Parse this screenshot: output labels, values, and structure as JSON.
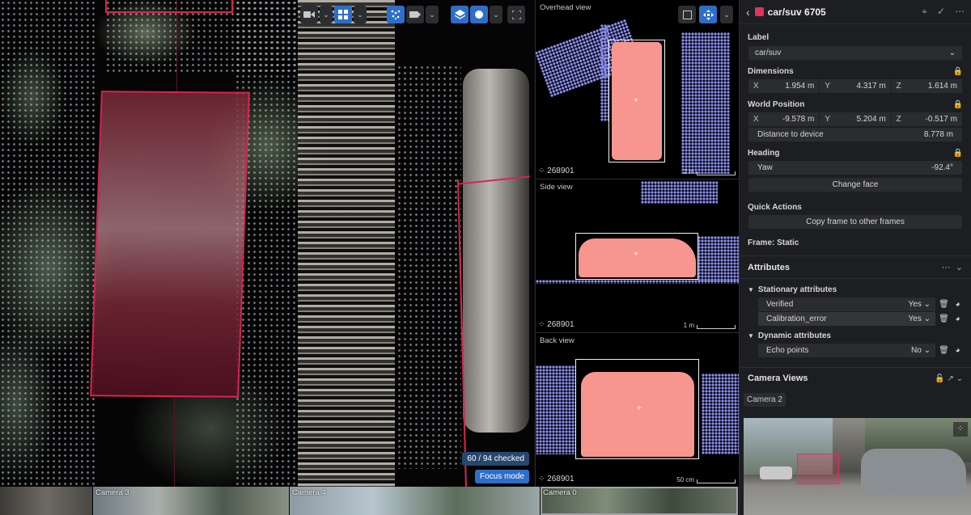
{
  "viewport": {
    "progress_badge": "60 / 94 checked",
    "focus_mode_label": "Focus mode",
    "toolbar": [
      {
        "icon": "video-camera-icon",
        "active": false
      },
      {
        "icon": "grid-layout-icon",
        "active": true
      },
      {
        "icon": "points-icon",
        "active": true
      },
      {
        "icon": "label-tag-icon",
        "active": false
      },
      {
        "icon": "layers-icon",
        "active": true
      },
      {
        "icon": "circle-icon",
        "active": true
      },
      {
        "icon": "fullscreen-icon",
        "active": false
      }
    ]
  },
  "views": {
    "overhead": {
      "label": "Overhead view",
      "id": "268901",
      "scale": "2 m"
    },
    "side": {
      "label": "Side view",
      "id": "268901",
      "scale": "1 m"
    },
    "back": {
      "label": "Back view",
      "id": "268901",
      "scale": "50 cm"
    }
  },
  "panel": {
    "title": "car/suv 6705",
    "accent_color": "#e0335a",
    "label_section": "Label",
    "label_value": "car/suv",
    "dimensions_section": "Dimensions",
    "dimensions": {
      "x_key": "X",
      "x": "1.954 m",
      "y_key": "Y",
      "y": "4.317 m",
      "z_key": "Z",
      "z": "1.614 m"
    },
    "world_position_section": "World Position",
    "world_position": {
      "x_key": "X",
      "x": "-9.578 m",
      "y_key": "Y",
      "y": "5.204 m",
      "z_key": "Z",
      "z": "-0.517 m"
    },
    "distance_label": "Distance to device",
    "distance_value": "8.778 m",
    "heading_section": "Heading",
    "yaw_label": "Yaw",
    "yaw_value": "-92.4°",
    "change_face_label": "Change face",
    "quick_actions_section": "Quick Actions",
    "copy_frame_label": "Copy frame to other frames",
    "frame_label": "Frame: Static",
    "attributes_section": "Attributes",
    "stationary_group": "Stationary attributes",
    "dynamic_group": "Dynamic attributes",
    "stationary": [
      {
        "name": "Verified",
        "value": "Yes"
      },
      {
        "name": "Calibration_error",
        "value": "Yes"
      }
    ],
    "dynamic": [
      {
        "name": "Echo points",
        "value": "No"
      }
    ],
    "camera_views_section": "Camera Views",
    "camera_chip": "Camera 2"
  },
  "camstrip": [
    {
      "label": ""
    },
    {
      "label": "Camera 3"
    },
    {
      "label": "Camera 4"
    },
    {
      "label": ""
    },
    {
      "label": "Camera 0"
    }
  ]
}
